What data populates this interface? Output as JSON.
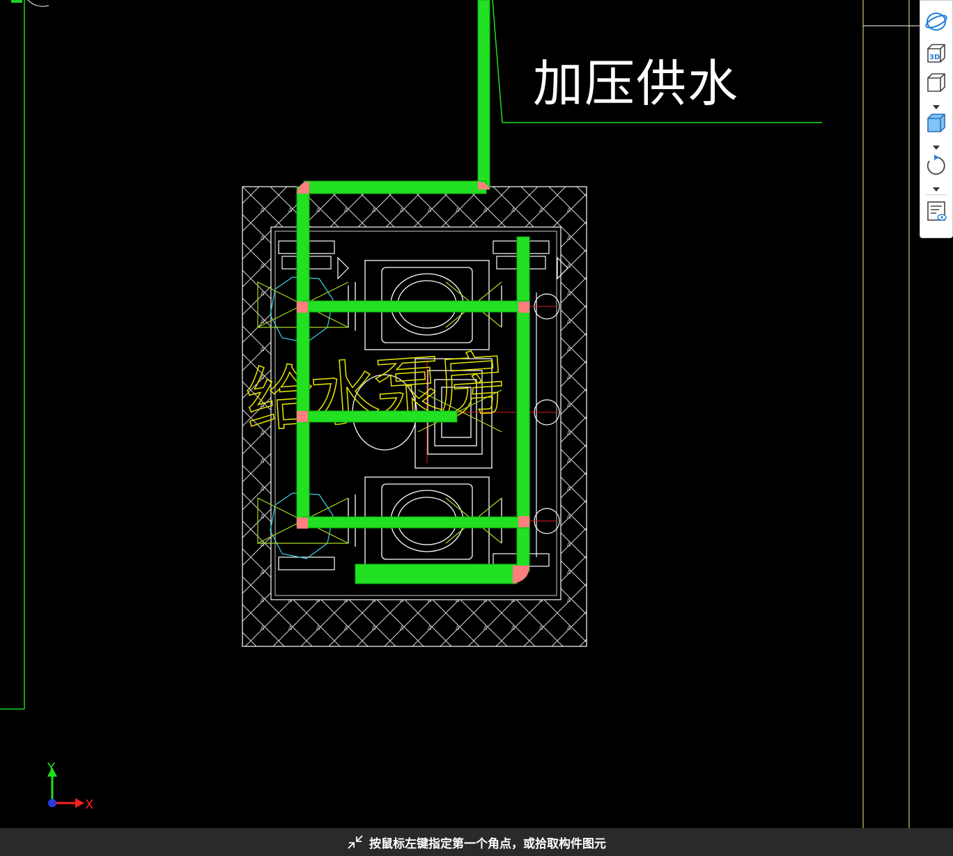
{
  "drawing": {
    "label_main": "加压供水",
    "label_room": "给水泵房",
    "axis_x": "X",
    "axis_y": "Y"
  },
  "toolbar": {
    "items": [
      {
        "icon": "orbit-icon"
      },
      {
        "icon": "3d-view-icon",
        "badge": "3D"
      },
      {
        "icon": "view-cube-icon"
      },
      {
        "icon": "shaded-cube-icon"
      },
      {
        "icon": "rotate-icon"
      },
      {
        "icon": "display-settings-icon"
      }
    ]
  },
  "status": {
    "message": "按鼠标左键指定第一个角点，或拾取构件图元"
  },
  "colors": {
    "background": "#000000",
    "pipe": "#22e022",
    "pipe_joint": "#ff7f7f",
    "linework": "#ffffff",
    "annotation": "#e6e600",
    "axis_y": "#20e020",
    "axis_x": "#ff2020",
    "status_bg": "#2a2a2a"
  }
}
